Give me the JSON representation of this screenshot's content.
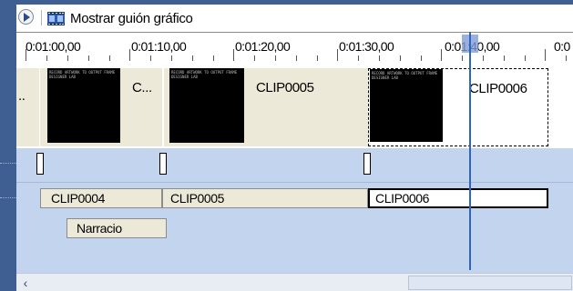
{
  "toolbar": {
    "play_icon": "play-icon",
    "storyboard_icon": "filmstrip-icon",
    "storyboard_label": "Mostrar guión gráfico"
  },
  "ruler": {
    "labels": [
      "0:01:00,00",
      "0:01:10,00",
      "0:01:20,00",
      "0:01:30,00",
      "0:01:40,00",
      "0:0"
    ]
  },
  "video_track": {
    "clips": [
      {
        "label": ".."
      },
      {
        "label": "C..."
      },
      {
        "label": "CLIP0005"
      },
      {
        "label": "CLIP0006"
      }
    ],
    "thumb_text": "RECORD ARTWORK TO OUTPUT\nFRAME DESIGNER LAB"
  },
  "audio_track": {
    "clips": [
      {
        "label": "CLIP0004"
      },
      {
        "label": "CLIP0005"
      },
      {
        "label": "CLIP0006"
      }
    ]
  },
  "narration_track": {
    "clip_label": "Narracio"
  },
  "colors": {
    "desktop": "#3f5f93",
    "track_bg": "#c3d4ef",
    "clip_bg": "#ece9d8",
    "playhead": "#2f63c6"
  },
  "scrollbar": {
    "left_arrow_icon": "chevron-left-icon"
  }
}
